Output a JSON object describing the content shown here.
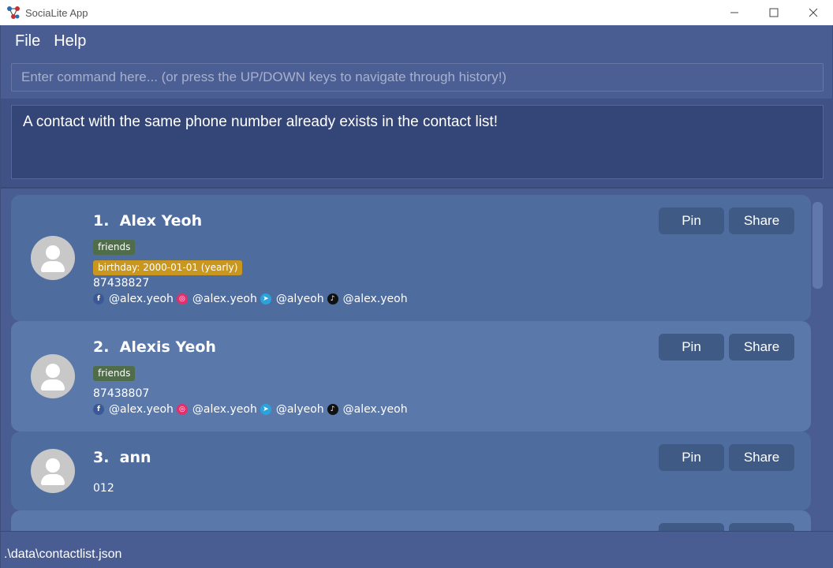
{
  "window": {
    "title": "SociaLite App",
    "minimize_icon": "minimize-icon",
    "maximize_icon": "maximize-icon",
    "close_icon": "close-icon"
  },
  "menu": {
    "file": "File",
    "help": "Help"
  },
  "command": {
    "placeholder": "Enter command here... (or press the UP/DOWN keys to navigate through history!)",
    "value": ""
  },
  "result": {
    "message": "A contact with the same phone number already exists in the contact list!"
  },
  "contacts": [
    {
      "name": "1.  Alex Yeoh",
      "tags": [
        "friends"
      ],
      "birthday": "birthday: 2000-01-01 (yearly)",
      "phone": "87438827",
      "facebook": "@alex.yeoh",
      "instagram": "@alex.yeoh",
      "telegram": "@alyeoh",
      "tiktok": "@alex.yeoh",
      "pin_label": "Pin",
      "share_label": "Share"
    },
    {
      "name": "2.  Alexis Yeoh",
      "tags": [
        "friends"
      ],
      "phone": "87438807",
      "facebook": "@alex.yeoh",
      "instagram": "@alex.yeoh",
      "telegram": "@alyeoh",
      "tiktok": "@alex.yeoh",
      "pin_label": "Pin",
      "share_label": "Share"
    },
    {
      "name": "3.  ann",
      "phone": "012",
      "pin_label": "Pin",
      "share_label": "Share"
    }
  ],
  "status": {
    "path": ".\\data\\contactlist.json"
  },
  "colors": {
    "window_bg": "#4a5d92",
    "card_even": "#5a78aa",
    "card_odd": "#4f6c9e",
    "button_bg": "#3e5a85",
    "tag_friends": "#4f6d49",
    "tag_birthday": "#c9971f"
  }
}
